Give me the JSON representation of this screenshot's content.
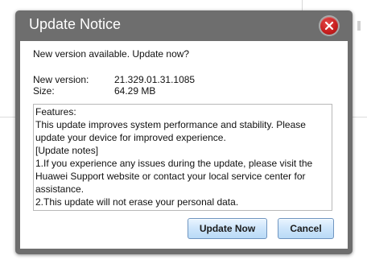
{
  "dialog": {
    "title": "Update Notice",
    "prompt": "New version available. Update now?",
    "version_label": "New version:",
    "version_value": "21.329.01.31.1085",
    "size_label": "Size:",
    "size_value": "64.29 MB",
    "features": [
      "Features:",
      "This update improves system performance and stability. Please",
      "update your device for improved experience.",
      "[Update notes]",
      "1.If you experience any issues during the update, please visit the",
      "Huawei Support website or contact your local service center for",
      "assistance.",
      "2.This update will not erase your personal data."
    ],
    "update_button": "Update Now",
    "cancel_button": "Cancel",
    "close_icon": "close-x-icon"
  },
  "colors": {
    "dialog_frame": "#6e6e6e",
    "close_red": "#c81f1f",
    "button_border": "#6f95c0"
  }
}
